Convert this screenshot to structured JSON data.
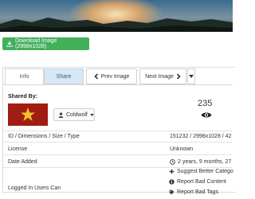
{
  "download": {
    "label": "Download Image (2998x1028)",
    "icon": "download-icon"
  },
  "tabs": [
    {
      "label": "Info"
    },
    {
      "label": "Share"
    },
    {
      "label": "Prev Image"
    },
    {
      "label": "Next Image"
    }
  ],
  "shared_by": {
    "label": "Shared By:",
    "username": "Coldwolf",
    "views": "235"
  },
  "details": {
    "id_label": "ID / Dimensions / Size / Type",
    "id_value": "151232 / 2998x1028 / 42",
    "license_label": "License",
    "license_value": "Unknown",
    "date_label": "Date Added",
    "date_value": "2 years, 9 months, 27",
    "logged_label": "Logged In Users Can"
  },
  "actions": [
    {
      "label": "Suggest Better Catego",
      "icon": "plus-icon"
    },
    {
      "label": "Report Bad Content",
      "icon": "info-icon"
    },
    {
      "label": "Report Bad Tags",
      "icon": "tag-icon"
    }
  ],
  "colors": {
    "accent_green": "#43b05c",
    "share_tab": "#d9e6f3"
  }
}
